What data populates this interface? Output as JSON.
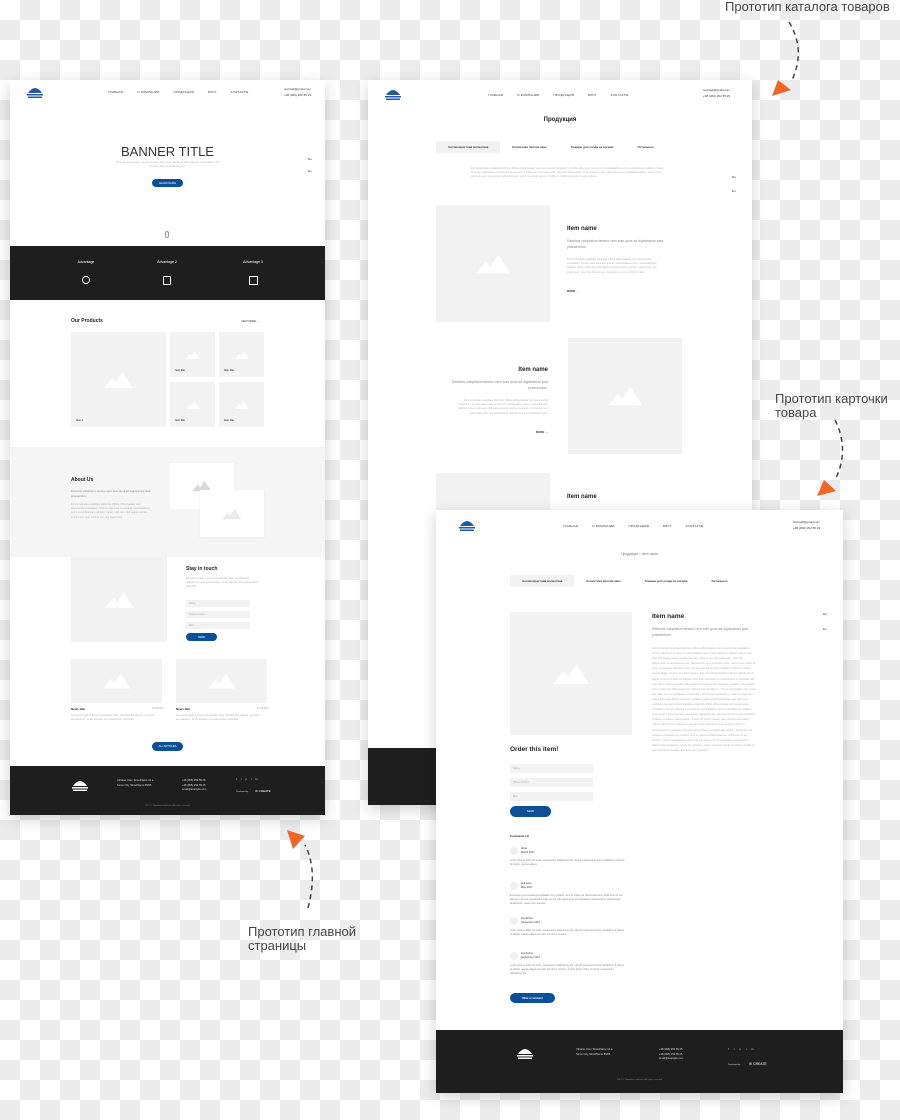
{
  "annotations": {
    "catalog": "Прототип каталога товаров",
    "card": "Прототип карточки товара",
    "main": "Прототип главной страницы"
  },
  "colors": {
    "accent": "#0b4f94",
    "dark": "#1e1e1e",
    "arrow": "#f26522",
    "placeholder": "#f2f2f2"
  },
  "header": {
    "logo": "WOODLINN LABOTECH",
    "nav": [
      "ГЛАВНАЯ",
      "О КОМПАНИИ",
      "ПРОДУКЦИЯ",
      "БЛОГ",
      "КОНТАКТЫ"
    ],
    "email": "testmail@gmail.com",
    "phone": "+38 (000) 252 55 23",
    "lang": [
      "Ru",
      "En"
    ]
  },
  "main_page": {
    "banner_title": "BANNER TITLE",
    "banner_text": "Vero iste doloremque, et accusantium iure, error architecto dolor aperiam aspernatur modi corrupti minus in obcaecati quo.",
    "learn_more": "LEARN MORE",
    "advantages": [
      "Advantage",
      "Advantage 2",
      "Advantage 3"
    ],
    "products_title": "Our Products",
    "view_more": "VIEW MORE →",
    "products": [
      "Item 1",
      "Item title",
      "Item title",
      "Item title",
      "Item title"
    ],
    "about_title": "About Us",
    "about_sub": "Delectus voluptatum tenetur vero eum quos ad dignissimos ipsa praesentium.",
    "about_text": "Est perspiciatis cupiditate distinctio officiis officia beatae vero assumenda voluptatum. Omnis nulla quos cumque id, necessitatibus sed in exercitationem adipisci, harum velit nam nihil eaque eveniet veniam eos quo, minima qui, rem aspernatur.",
    "stay_title": "Stay in touch",
    "stay_text": "Excepturi fugiat a neque perspiciatis dolor repudiandae deleniti. Corporis accusantium, et illo aliquam sint praesentium blanditiis.",
    "fields": [
      "Name",
      "Phone number",
      "Mail"
    ],
    "send": "SEND",
    "news": [
      {
        "title": "News title",
        "date": "12.03.2017",
        "text": "Excepturi fugiat a neque perspiciatis dolor repudiandae deleniti. Corporis accusantium, et illo aliquam sint praesentium blanditiis."
      },
      {
        "title": "News title",
        "date": "12.03.2017",
        "text": "Excepturi fugiat a neque perspiciatis dolor repudiandae deleniti. Corporis accusantium, et illo aliquam sint praesentium blanditiis."
      }
    ],
    "all_articles": "ALL ARTICLES"
  },
  "catalog_page": {
    "title": "Продукция",
    "tabs": [
      "Антивозрастная косметика",
      "Косметика против акне",
      "Товары для ухода за ногами",
      "Остальное"
    ],
    "description": "Est perspiciatis cupiditate distinctio officiis officia beatae vero assumenda voluptatum. Omnis nulla quos cumque id, necessitatibus sed in exercitationem adipisci, harum velit nam nihil eaque eveniet veniam eos quo, minima qui, rem aspernatur. Vero iste doloremque, et accusantium iure, dignissimos error architecto dolor. Lorem ipsum dolor sit amet, consectetur adipisicing elit, sed do eiusmod tempor incididunt ut labore et dolore magna aliqua.",
    "item_name": "Item name",
    "item_sub": "Delectus voluptatum tenetur vero eum quos ad dignissimos ipsa praesentium.",
    "item_text": "Est perspiciatis cupiditate distinctio officiis officia beatae vero assumenda voluptatum. Omnis nulla quos cumque id, necessitatibus sed in exercitationem adipisci, harum velit nam nihil eaque eveniet veniam eos quo, minima qui, rem aspernatur. Vero iste doloremque, dignissimos error architecto dolor.",
    "more": "MORE →"
  },
  "card_page": {
    "breadcrumb": [
      "Продукция",
      "Item name"
    ],
    "order_title": "Order this item!",
    "comments_title": "Comments (4)",
    "comments": [
      {
        "name": "olivia",
        "date": "March 2017",
        "text": "Lorem ipsum dolor sit amet, consectetur adipisicing elit. Sed do eiusmod tempor incididunt ut labore et dolore magna aliqua."
      },
      {
        "name": "jenkayup",
        "date": "May 2017",
        "text": "Excepteur sint occaecat cupidatat non proident, sunt in culpa qui officia deserunt mollit anim id est laborum. Sed ut perspiciatis unde omnis iste natus error sit voluptatem accusantium doloremque laudantium, totam rem aperiam."
      },
      {
        "name": "kombrcha",
        "date": "September 2017",
        "text": "Lorem ipsum dolor sit amet, consectetur adipisicing elit, sed do eiusmod tempor incididunt ut labore et dolore magna aliqua Ut enim ad minim veniam."
      },
      {
        "name": "kombrcha",
        "date": "September 2017",
        "text": "Lorem ipsum dolor sit amet, consectetur adipisicing elit, sed do eiusmod tempor incididunt ut labore et dolore magna aliqua Ut enim ad minim veniam. Lorem ipsum dolor sit amet, consectetur adipisicing elit."
      }
    ],
    "write_comment": "Write a comment",
    "long_text": "Est perspiciatis cupiditate distinctio officiis officia beatae vero assumenda voluptatum. Omnis nulla quos cumque id, necessitatibus sed in exercitationem adipisci, harum velit nam nihil eaque eveniet veniam eos quo, minima qui, rem aspernatur. Vero iste doloremque, et accusantium iure, dignissimos error architecto dolor. Lorem ipsum dolor sit amet, consectetur adipisicing elit, sed do eiusmod tempor incididunt ut labore et dolore magna aliqua. Ut enim ad minim veniam, quis nostrud exercitation ullamco laboris nisi ut aliquip ex ea commodo consequat. Duis aute irure dolor in reprehenderit in voluptate velit esse cillum dolore eu fugiat nulla pariatur. Excepteur sint occaecat cupidatat non proident, sunt in culpa qui officia deserunt mollit anim id est laborum. Sed ut perspiciatis unde omnis iste natus error sit voluptatem accusantium doloremque laudantium, totam rem aperiam, eaque ipsa quae ab illo inventore veritatis et quasi architecto beatae vitae dicta sunt explicabo. Est perspiciatis cupiditate distinctio officiis officia beatae vero assumenda voluptatum. Omnis nulla quos cumque id, necessitatibus sed in exercitationem adipisci. Lorem ipsum dolor sit amet, consectetur adipisicing elit, sed do eiusmod tempor incididunt ut labore et dolore magna aliqua. Ut enim ad minim veniam, quis nostrud exercitation ullamco laboris nisi ut aliquip ex ea commodo consequat. Duis aute irure dolor in reprehenderit in voluptate velit esse cillum dolore eu fugiat nulla pariatur. Excepteur sint occaecat cupidatat non proident, sunt in culpa qui officia deserunt mollit anim id est laborum. Sed ut perspiciatis unde omnis iste natus error sit voluptatem accusantium doloremque laudantium, totam rem aperiam, eaque ipsa quae ab illo inventore veritatis et quasi architecto beatae vitae dicta sunt explicabo."
  },
  "footer": {
    "address": [
      "Ukraine, Kiev, StreetName 14 a",
      "Some City, StreetName 85/86"
    ],
    "phones": [
      "+38 (095) 252 55 25",
      "+38 (095) 252 55 25",
      "email@example.com"
    ],
    "social": [
      "f",
      "t",
      "p",
      "i",
      "in"
    ],
    "developed_by": "Developed by",
    "developer": "IK CREATE",
    "copyright": "2017 © Woodlinn Labotech. All rights reserved"
  }
}
